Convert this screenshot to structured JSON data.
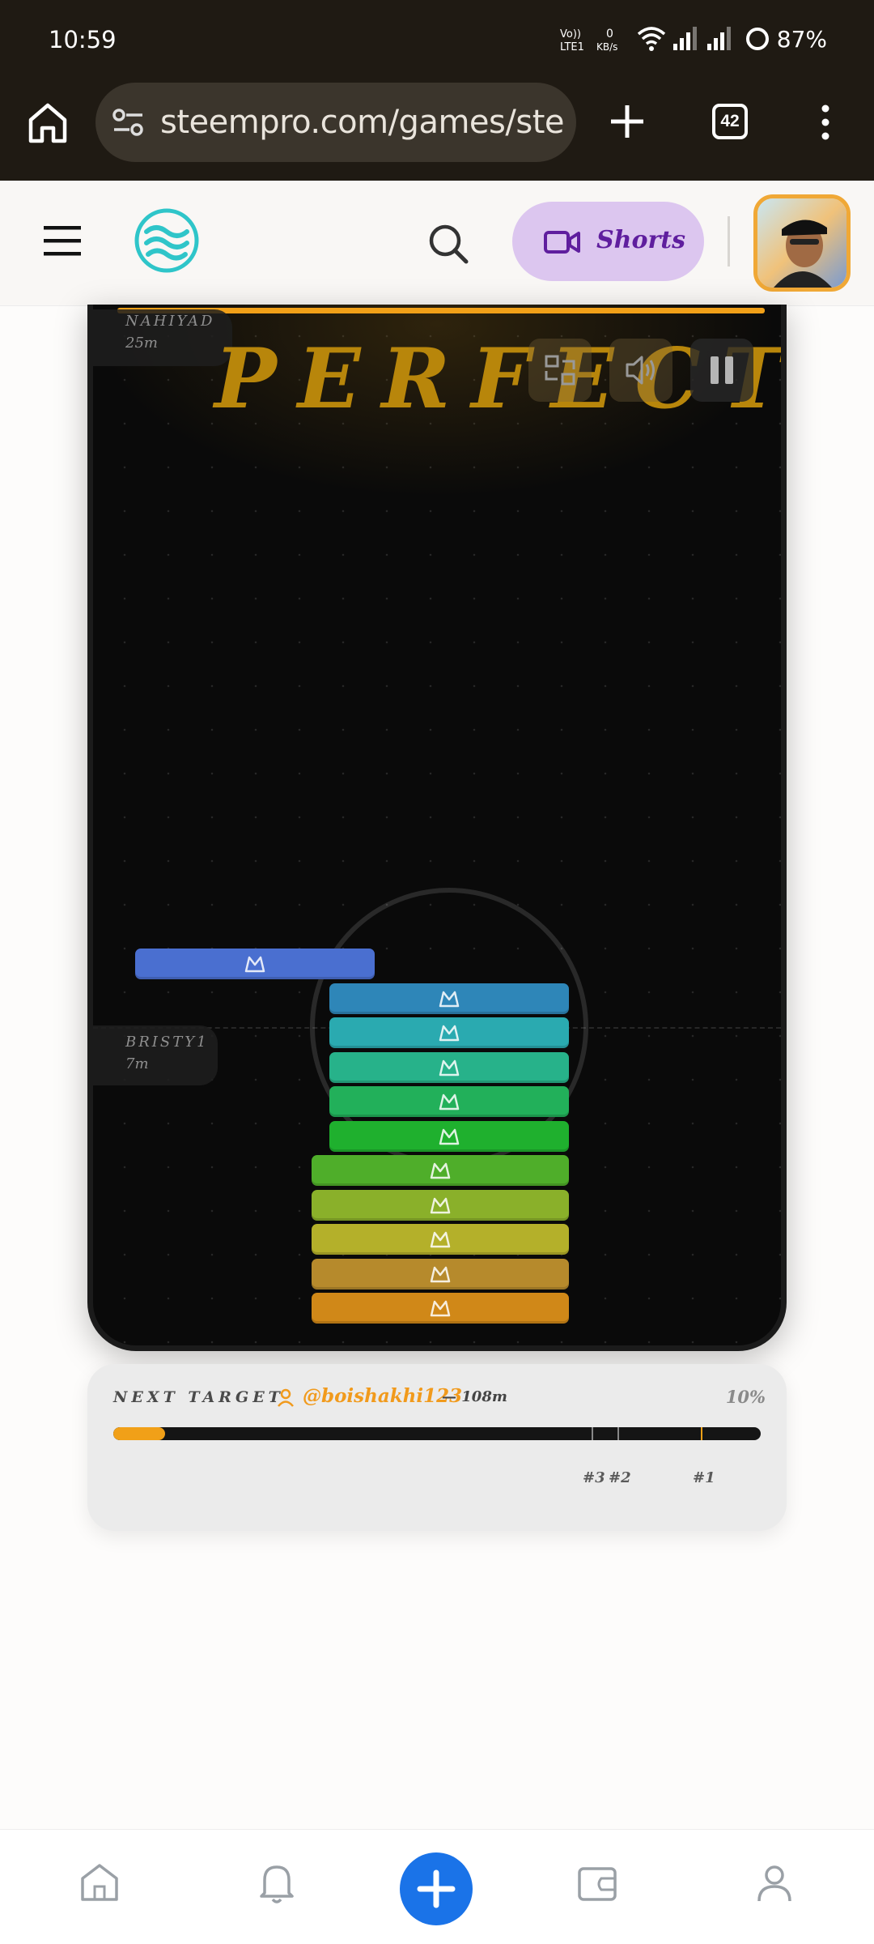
{
  "status_bar": {
    "time": "10:59",
    "battery": "87%",
    "network_label": "VoLTE1",
    "speed_label": "0 KB/s"
  },
  "browser": {
    "url": "steempro.com/games/steer",
    "tab_count": "42"
  },
  "header": {
    "shorts_label": "Shorts"
  },
  "game": {
    "banner": "PERFECT!",
    "players": [
      {
        "name": "NAHIYAD",
        "distance": "25m"
      },
      {
        "name": "BRISTY1",
        "distance": "7m"
      }
    ],
    "colors": {
      "accent": "#f1a018",
      "banner": "#b8860b"
    },
    "blocks": [
      {
        "color": "#4a6fd0"
      },
      {
        "color": "#2e86b8"
      },
      {
        "color": "#2aaab0"
      },
      {
        "color": "#27b28a"
      },
      {
        "color": "#22b05a"
      },
      {
        "color": "#1fb02e"
      },
      {
        "color": "#4fae2a"
      },
      {
        "color": "#8ab02a"
      },
      {
        "color": "#b4b02a"
      },
      {
        "color": "#b68a2c"
      },
      {
        "color": "#d08818"
      }
    ]
  },
  "next_target": {
    "label": "NEXT TARGET",
    "user": "@boishakhi123",
    "distance": "— 108m",
    "percent": "10%",
    "progress": 0.08,
    "ranks": [
      "#3",
      "#2",
      "#1"
    ]
  },
  "bottom_nav": {
    "items": [
      "home-icon",
      "bell-icon",
      "plus-icon",
      "wallet-icon",
      "profile-icon"
    ]
  }
}
